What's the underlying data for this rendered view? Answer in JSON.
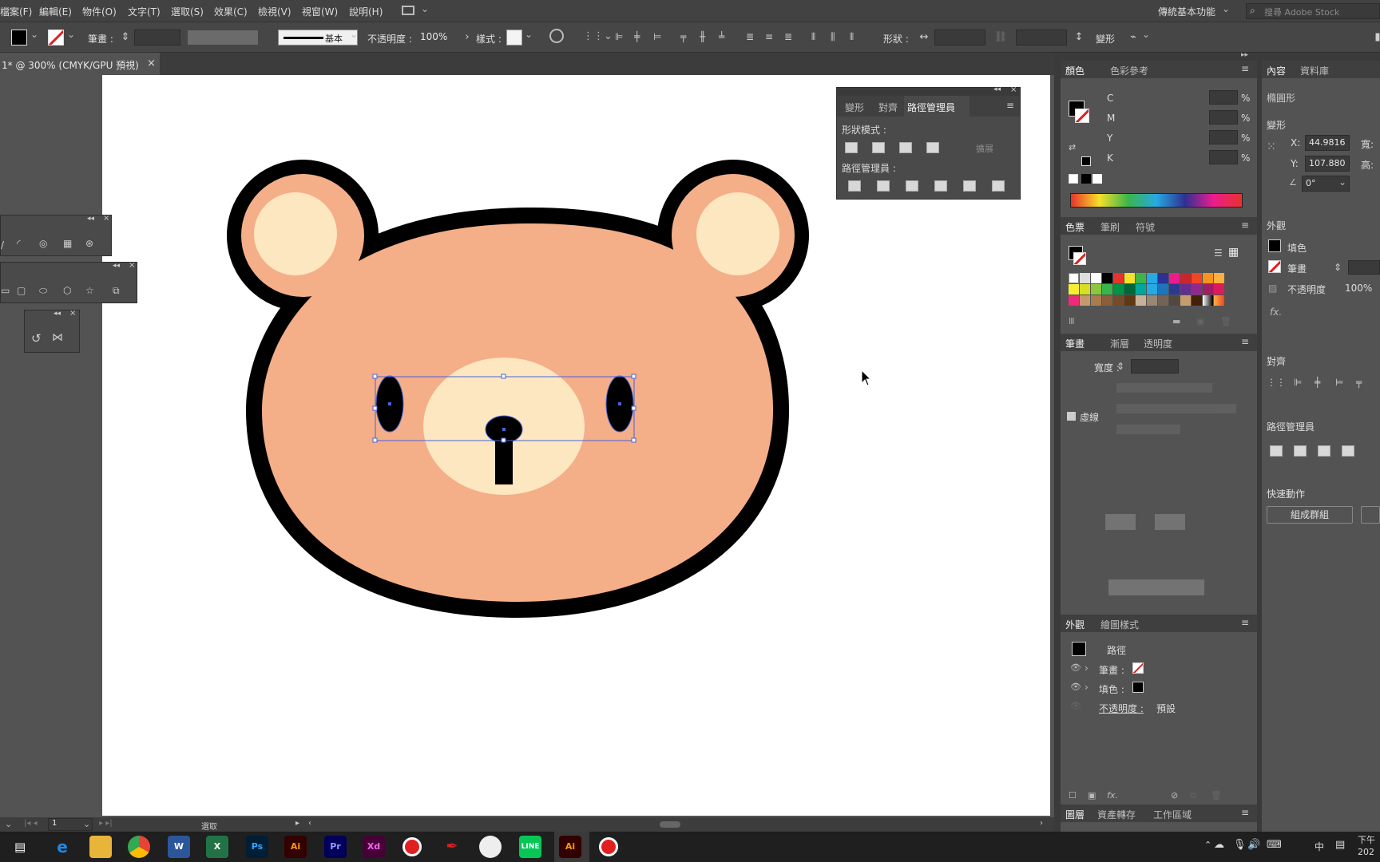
{
  "menubar": {
    "items": [
      "檔案(F)",
      "編輯(E)",
      "物件(O)",
      "文字(T)",
      "選取(S)",
      "效果(C)",
      "檢視(V)",
      "視窗(W)",
      "說明(H)"
    ],
    "workspace": "傳統基本功能",
    "search_placeholder": "搜尋 Adobe Stock"
  },
  "controlbar": {
    "stroke_label": "筆畫 :",
    "stroke_style": "基本",
    "opacity_label": "不透明度 :",
    "opacity_value": "100%",
    "style_label": "樣式 :",
    "shape_label": "形狀 :",
    "transform_label": "變形"
  },
  "document": {
    "tab_title": "1* @ 300% (CMYK/GPU 預視)",
    "zoom": "1",
    "status_text": "選取"
  },
  "pathfinder_panel": {
    "tabs": [
      "變形",
      "對齊",
      "路徑管理員"
    ],
    "shape_modes_label": "形狀模式 :",
    "expand_label": "擴展",
    "pathfinders_label": "路徑管理員 :"
  },
  "color_panel": {
    "tabs": [
      "顏色",
      "色彩參考"
    ],
    "channels": [
      "C",
      "M",
      "Y",
      "K"
    ],
    "percent": "%"
  },
  "swatches_panel": {
    "tabs": [
      "色票",
      "筆刷",
      "符號"
    ]
  },
  "stroke_panel": {
    "tabs": [
      "筆畫",
      "漸層",
      "透明度"
    ],
    "weight_label": "寬度 :",
    "dashed_label": "虛線"
  },
  "appearance_panel": {
    "tabs": [
      "外觀",
      "繪圖樣式"
    ],
    "object_label": "路徑",
    "stroke_label": "筆畫 :",
    "fill_label": "填色 :",
    "opacity_label": "不透明度 :",
    "opacity_value": "預設"
  },
  "bottom_tabs": [
    "圖層",
    "資產轉存",
    "工作區域"
  ],
  "properties_panel": {
    "tabs": [
      "內容",
      "資料庫"
    ],
    "object_type": "橢圓形",
    "transform_label": "變形",
    "x_label": "X:",
    "x_value": "44.9816",
    "y_label": "Y:",
    "y_value": "107.880",
    "w_label": "寬:",
    "h_label": "高:",
    "angle_value": "0°",
    "appearance_label": "外觀",
    "fill_label": "填色",
    "stroke_label": "筆畫",
    "opacity_label": "不透明度",
    "opacity_value": "100%",
    "fx_label": "fx.",
    "align_label": "對齊",
    "pathfinder_label": "路徑管理員",
    "quick_actions_label": "快速動作",
    "group_button": "組成群組"
  },
  "taskbar": {
    "apps": [
      "Ps",
      "Ai",
      "Pr",
      "Xd",
      "Ai"
    ],
    "time": "下午",
    "date": "202",
    "ime": "中"
  },
  "colors": {
    "bear_face": "#f4ae88",
    "bear_inner": "#fde7c0",
    "outline": "#000000",
    "selection": "#4a63d8"
  }
}
